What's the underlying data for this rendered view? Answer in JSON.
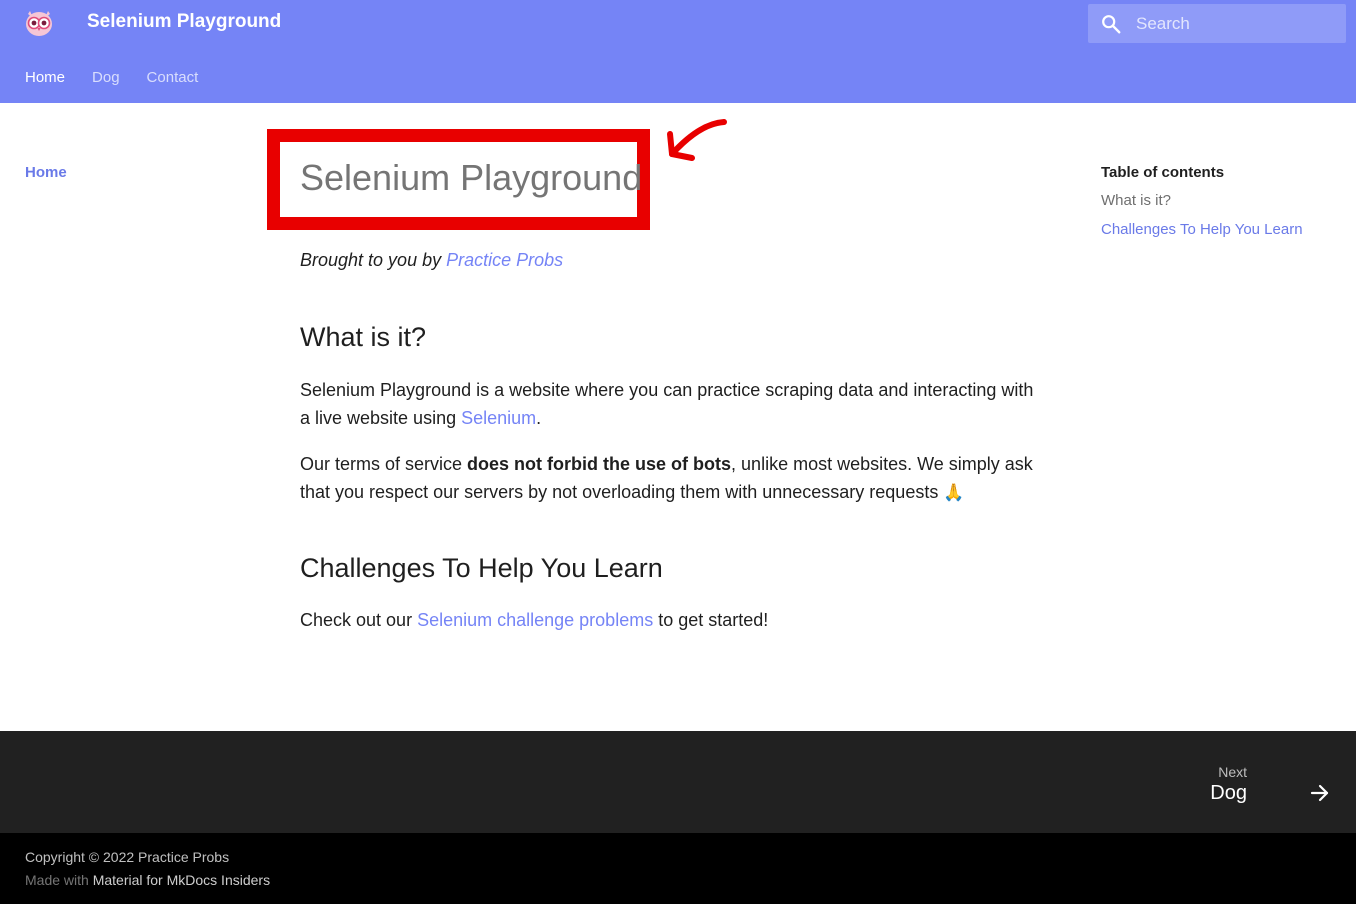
{
  "header": {
    "title": "Selenium Playground",
    "search_placeholder": "Search",
    "tabs": [
      {
        "label": "Home",
        "active": true
      },
      {
        "label": "Dog",
        "active": false
      },
      {
        "label": "Contact",
        "active": false
      }
    ]
  },
  "left_nav": {
    "items": [
      {
        "label": "Home",
        "active": true
      }
    ]
  },
  "content": {
    "title": "Selenium Playground",
    "byline_prefix": "Brought to you by ",
    "byline_link": "Practice Probs",
    "section1": {
      "heading": "What is it?",
      "p1_text": "Selenium Playground is a website where you can practice scraping data and interacting with a live website using ",
      "p1_link": "Selenium",
      "p1_end": ".",
      "p2_prefix": "Our terms of service ",
      "p2_bold": "does not forbid the use of bots",
      "p2_suffix": ", unlike most websites. We simply ask that you respect our servers by not overloading them with unnecessary requests ",
      "p2_emoji": "🙏"
    },
    "section2": {
      "heading": "Challenges To Help You Learn",
      "p_prefix": "Check out our ",
      "p_link": "Selenium challenge problems",
      "p_suffix": " to get started!"
    }
  },
  "toc": {
    "title": "Table of contents",
    "items": [
      {
        "label": "What is it?",
        "active": false
      },
      {
        "label": "Challenges To Help You Learn",
        "active": true
      }
    ]
  },
  "footer": {
    "next_label": "Next",
    "next_title": "Dog",
    "copyright": "Copyright © 2022 Practice Probs",
    "made_with_prefix": "Made with ",
    "made_with_link": "Material for MkDocs Insiders"
  },
  "colors": {
    "primary": "#7584f6",
    "highlight": "#e80000",
    "footer_dark": "#212121",
    "footer_black": "#000000"
  }
}
